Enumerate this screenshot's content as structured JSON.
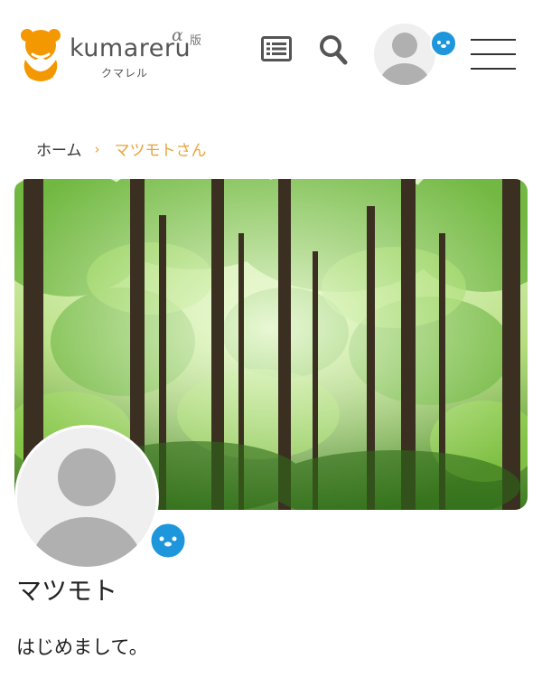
{
  "header": {
    "logo_name": "kumareru",
    "logo_alpha": "α",
    "logo_version": "版",
    "logo_kana": "クマレル",
    "colors": {
      "brand_orange": "#F39800",
      "badge_blue": "#1E96DC"
    },
    "icons": [
      "list-icon",
      "search-icon",
      "user-avatar-icon",
      "badge-icon",
      "hamburger-menu-icon"
    ]
  },
  "breadcrumb": {
    "home": "ホーム",
    "separator": "›",
    "current": "マツモトさん"
  },
  "profile": {
    "name": "マツモト",
    "bio": "はじめまして。"
  }
}
